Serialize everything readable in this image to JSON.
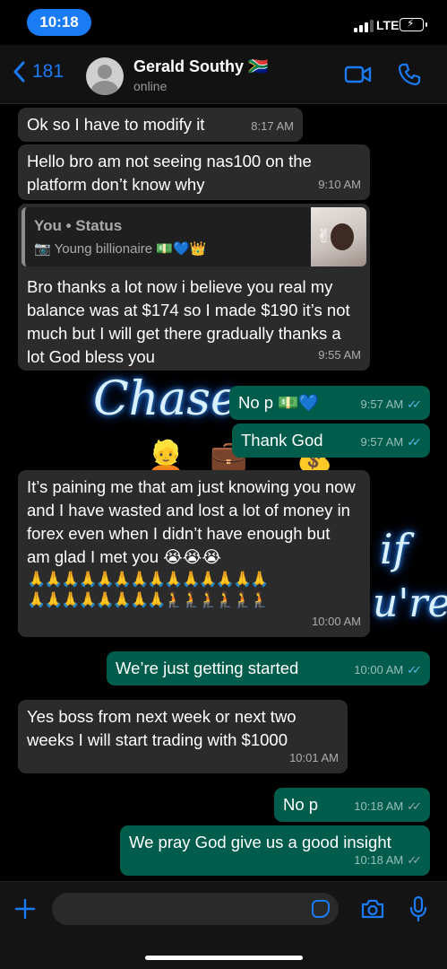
{
  "status_bar": {
    "time": "10:18",
    "network": "LTE"
  },
  "header": {
    "back_count": "181",
    "contact_name": "Gerald Southy 🇿🇦",
    "contact_status": "online"
  },
  "wallpaper": {
    "word1": "Chase",
    "word2": "if",
    "word3": "u're"
  },
  "messages": [
    {
      "id": "m1",
      "direction": "in",
      "text": "Ok so I have to modify it",
      "time": "8:17 AM"
    },
    {
      "id": "m2",
      "direction": "in",
      "text": "Hello bro am not seeing nas100 on the platform don’t know why",
      "time": "9:10 AM"
    },
    {
      "id": "m3",
      "direction": "in",
      "quote": {
        "title": "You • Status",
        "caption": "Young billionaire 💵💙👑"
      },
      "text": "Bro thanks a lot now i believe you real my balance was at $174 so I made $190 it’s not much but I will get there gradually thanks a lot God bless you",
      "time": "9:55 AM"
    },
    {
      "id": "m4",
      "direction": "out",
      "text": "No p 💵💙",
      "time": "9:57 AM",
      "read": true
    },
    {
      "id": "m5",
      "direction": "out",
      "text": "Thank God",
      "time": "9:57 AM",
      "read": true
    },
    {
      "id": "m6",
      "direction": "in",
      "text": "It’s paining me that am just knowing you now and I have wasted and lost a lot of money in forex even when I didn’t have enough but am glad I met you 😭😭😭",
      "emoji_row1": "🙏🙏🙏🙏🙏🙏🙏🙏🙏🙏🙏🙏🙏🙏",
      "emoji_row2": "🙏🙏🙏🙏🙏🙏🙏🙏🧎🧎🧎🧎🧎🧎",
      "time": "10:00 AM"
    },
    {
      "id": "m7",
      "direction": "out",
      "text": "We’re just getting started",
      "time": "10:00 AM",
      "read": true
    },
    {
      "id": "m8",
      "direction": "in",
      "text": "Yes boss from next week or next two weeks I will start trading with $1000",
      "time": "10:01 AM"
    },
    {
      "id": "m9",
      "direction": "out",
      "text": "No p",
      "time": "10:18 AM",
      "read": false
    },
    {
      "id": "m10",
      "direction": "out",
      "text": "We pray God give us a good insight",
      "time": "10:18 AM",
      "read": false
    }
  ],
  "colors": {
    "accent": "#1a7cf5",
    "incoming_bubble": "#2b2b2b",
    "outgoing_bubble": "#005c4b",
    "read_ticks": "#53bdeb",
    "delivered_ticks": "#9aa7ab"
  },
  "input": {
    "placeholder": ""
  }
}
